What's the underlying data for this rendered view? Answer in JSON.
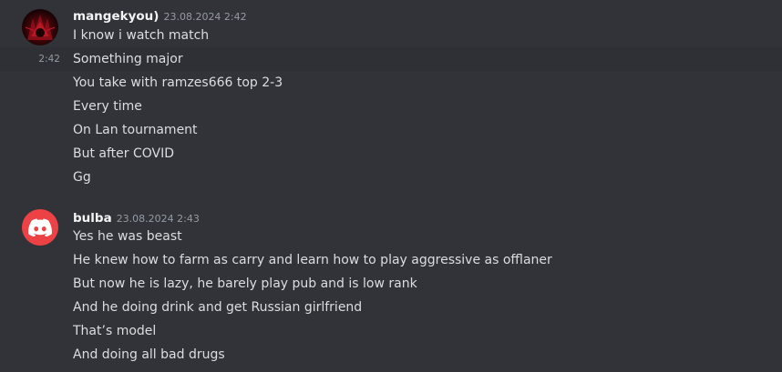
{
  "colors": {
    "background": "#313338",
    "hover_row": "#2e3035",
    "username": "#f2f3f5",
    "text": "#dbdee1",
    "muted": "#949ba4",
    "discord_red": "#ed4245"
  },
  "messages": [
    {
      "author": "mangekyou)",
      "timestamp": "23.08.2024 2:42",
      "hover_time": "2:42",
      "avatar_icon": "dark-red-avatar-icon",
      "lines": [
        "I know i watch match",
        "Something major",
        "You take with ramzes666 top 2-3",
        "Every time",
        "On Lan tournament",
        "But after COVID",
        "Gg"
      ]
    },
    {
      "author": "bulba",
      "timestamp": "23.08.2024 2:43",
      "avatar_icon": "discord-logo-icon",
      "lines": [
        "Yes he was beast",
        "He knew how to farm as carry and learn how to play aggressive as offlaner",
        "But now he is lazy, he barely play pub and is low rank",
        "And he doing drink and get Russian girlfriend",
        "That’s model",
        "And doing all bad drugs"
      ]
    }
  ]
}
